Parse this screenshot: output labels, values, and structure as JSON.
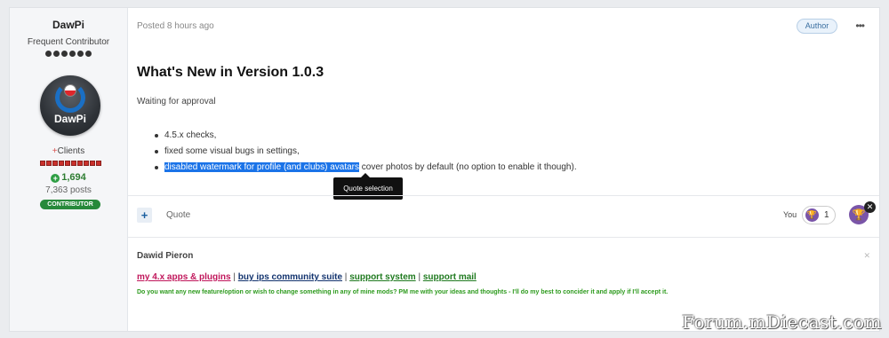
{
  "author": {
    "name": "DawPi",
    "title": "Frequent Contributor",
    "avatar_text": "DawPi",
    "group_prefix": "+",
    "group": "Clients",
    "reputation": "1,694",
    "posts": "7,363 posts",
    "badge": "CONTRIBUTOR"
  },
  "post": {
    "posted": "Posted 8 hours ago",
    "author_badge": "Author",
    "more": "•••",
    "title": "What's New in Version 1.0.3",
    "status": "Waiting for approval",
    "changes": [
      "4.5.x checks,",
      "fixed some visual bugs in settings,"
    ],
    "change3_highlight": "disabled watermark for profile (and clubs) avatars",
    "change3_rest": " cover photos by default (no option to enable it though).",
    "quote_tooltip": "Quote selection"
  },
  "actions": {
    "plus": "+",
    "quote": "Quote",
    "you": "You",
    "reaction_count": "1"
  },
  "signature": {
    "name": "Dawid Pieron",
    "close": "✕",
    "links": [
      "my 4.x apps & plugins",
      "buy ips community suite",
      "support system",
      "support mail"
    ],
    "separator": "|",
    "note": "Do you want any new feature/option or wish to change something in any of mine mods? PM me with your ideas and thoughts - I'll do my best to concider it and apply if I'll accept it."
  },
  "watermark": "Forum.mDiecast.com",
  "colors": {
    "highlight": "#1a73e8",
    "reaction": "#7a55a8",
    "contributor": "#27893a"
  }
}
